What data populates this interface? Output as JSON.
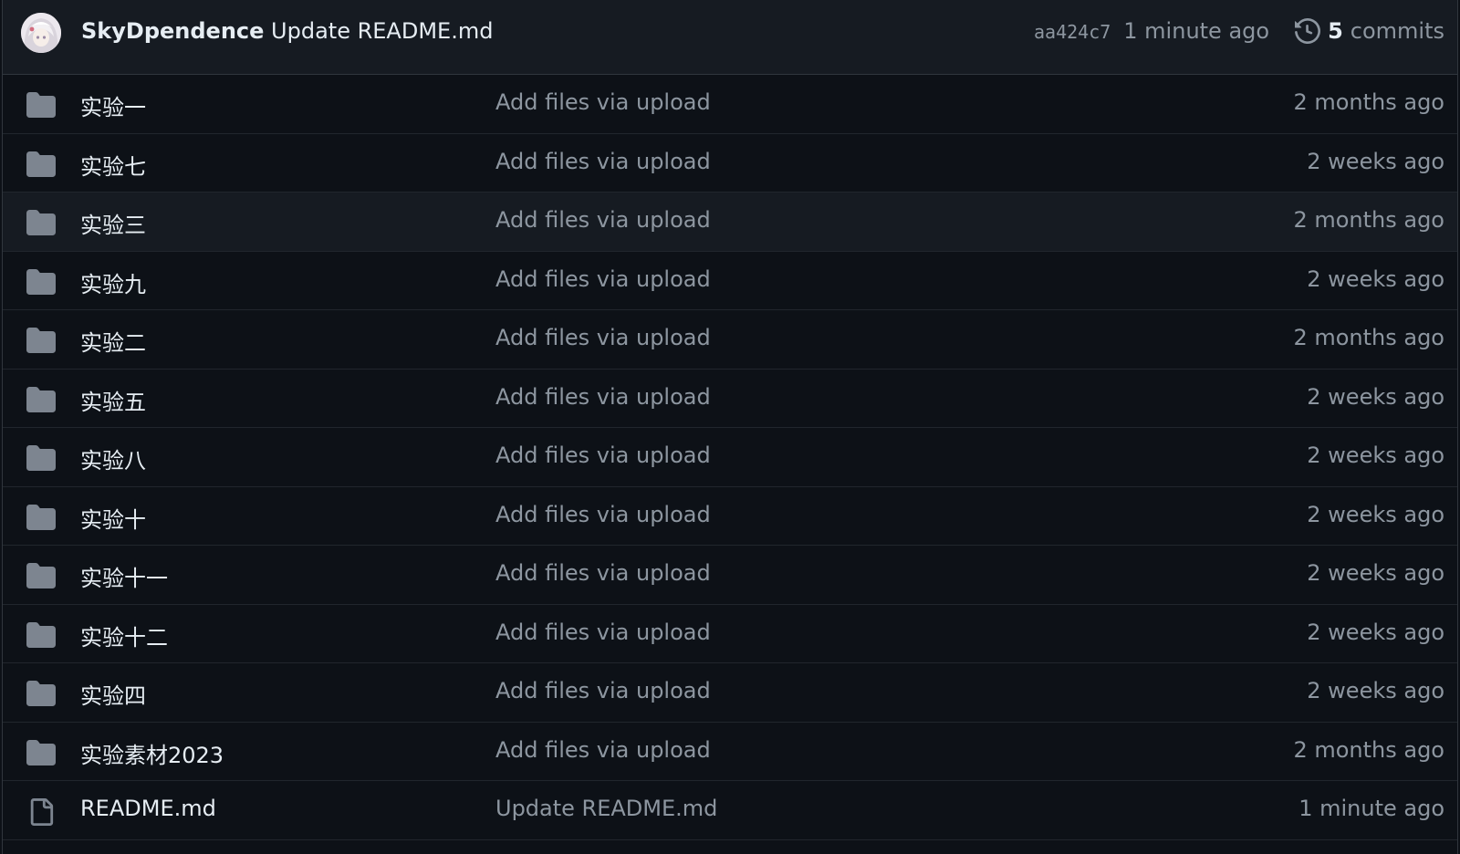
{
  "commit": {
    "author": "SkyDpendence",
    "message": "Update README.md",
    "sha": "aa424c7",
    "time": "1 minute ago",
    "commits_count": "5",
    "commits_label": "commits"
  },
  "files": [
    {
      "type": "folder",
      "name": "实验一",
      "message": "Add files via upload",
      "age": "2 months ago"
    },
    {
      "type": "folder",
      "name": "实验七",
      "message": "Add files via upload",
      "age": "2 weeks ago"
    },
    {
      "type": "folder",
      "name": "实验三",
      "message": "Add files via upload",
      "age": "2 months ago"
    },
    {
      "type": "folder",
      "name": "实验九",
      "message": "Add files via upload",
      "age": "2 weeks ago"
    },
    {
      "type": "folder",
      "name": "实验二",
      "message": "Add files via upload",
      "age": "2 months ago"
    },
    {
      "type": "folder",
      "name": "实验五",
      "message": "Add files via upload",
      "age": "2 weeks ago"
    },
    {
      "type": "folder",
      "name": "实验八",
      "message": "Add files via upload",
      "age": "2 weeks ago"
    },
    {
      "type": "folder",
      "name": "实验十",
      "message": "Add files via upload",
      "age": "2 weeks ago"
    },
    {
      "type": "folder",
      "name": "实验十一",
      "message": "Add files via upload",
      "age": "2 weeks ago"
    },
    {
      "type": "folder",
      "name": "实验十二",
      "message": "Add files via upload",
      "age": "2 weeks ago"
    },
    {
      "type": "folder",
      "name": "实验四",
      "message": "Add files via upload",
      "age": "2 weeks ago"
    },
    {
      "type": "folder",
      "name": "实验素材2023",
      "message": "Add files via upload",
      "age": "2 months ago"
    },
    {
      "type": "file",
      "name": "README.md",
      "message": "Update README.md",
      "age": "1 minute ago"
    }
  ],
  "colors": {
    "background": "#0d1117",
    "header_background": "#161b22",
    "text": "#e6edf3",
    "muted": "#8d96a0",
    "icon": "#7d8590",
    "border": "#30363d"
  }
}
